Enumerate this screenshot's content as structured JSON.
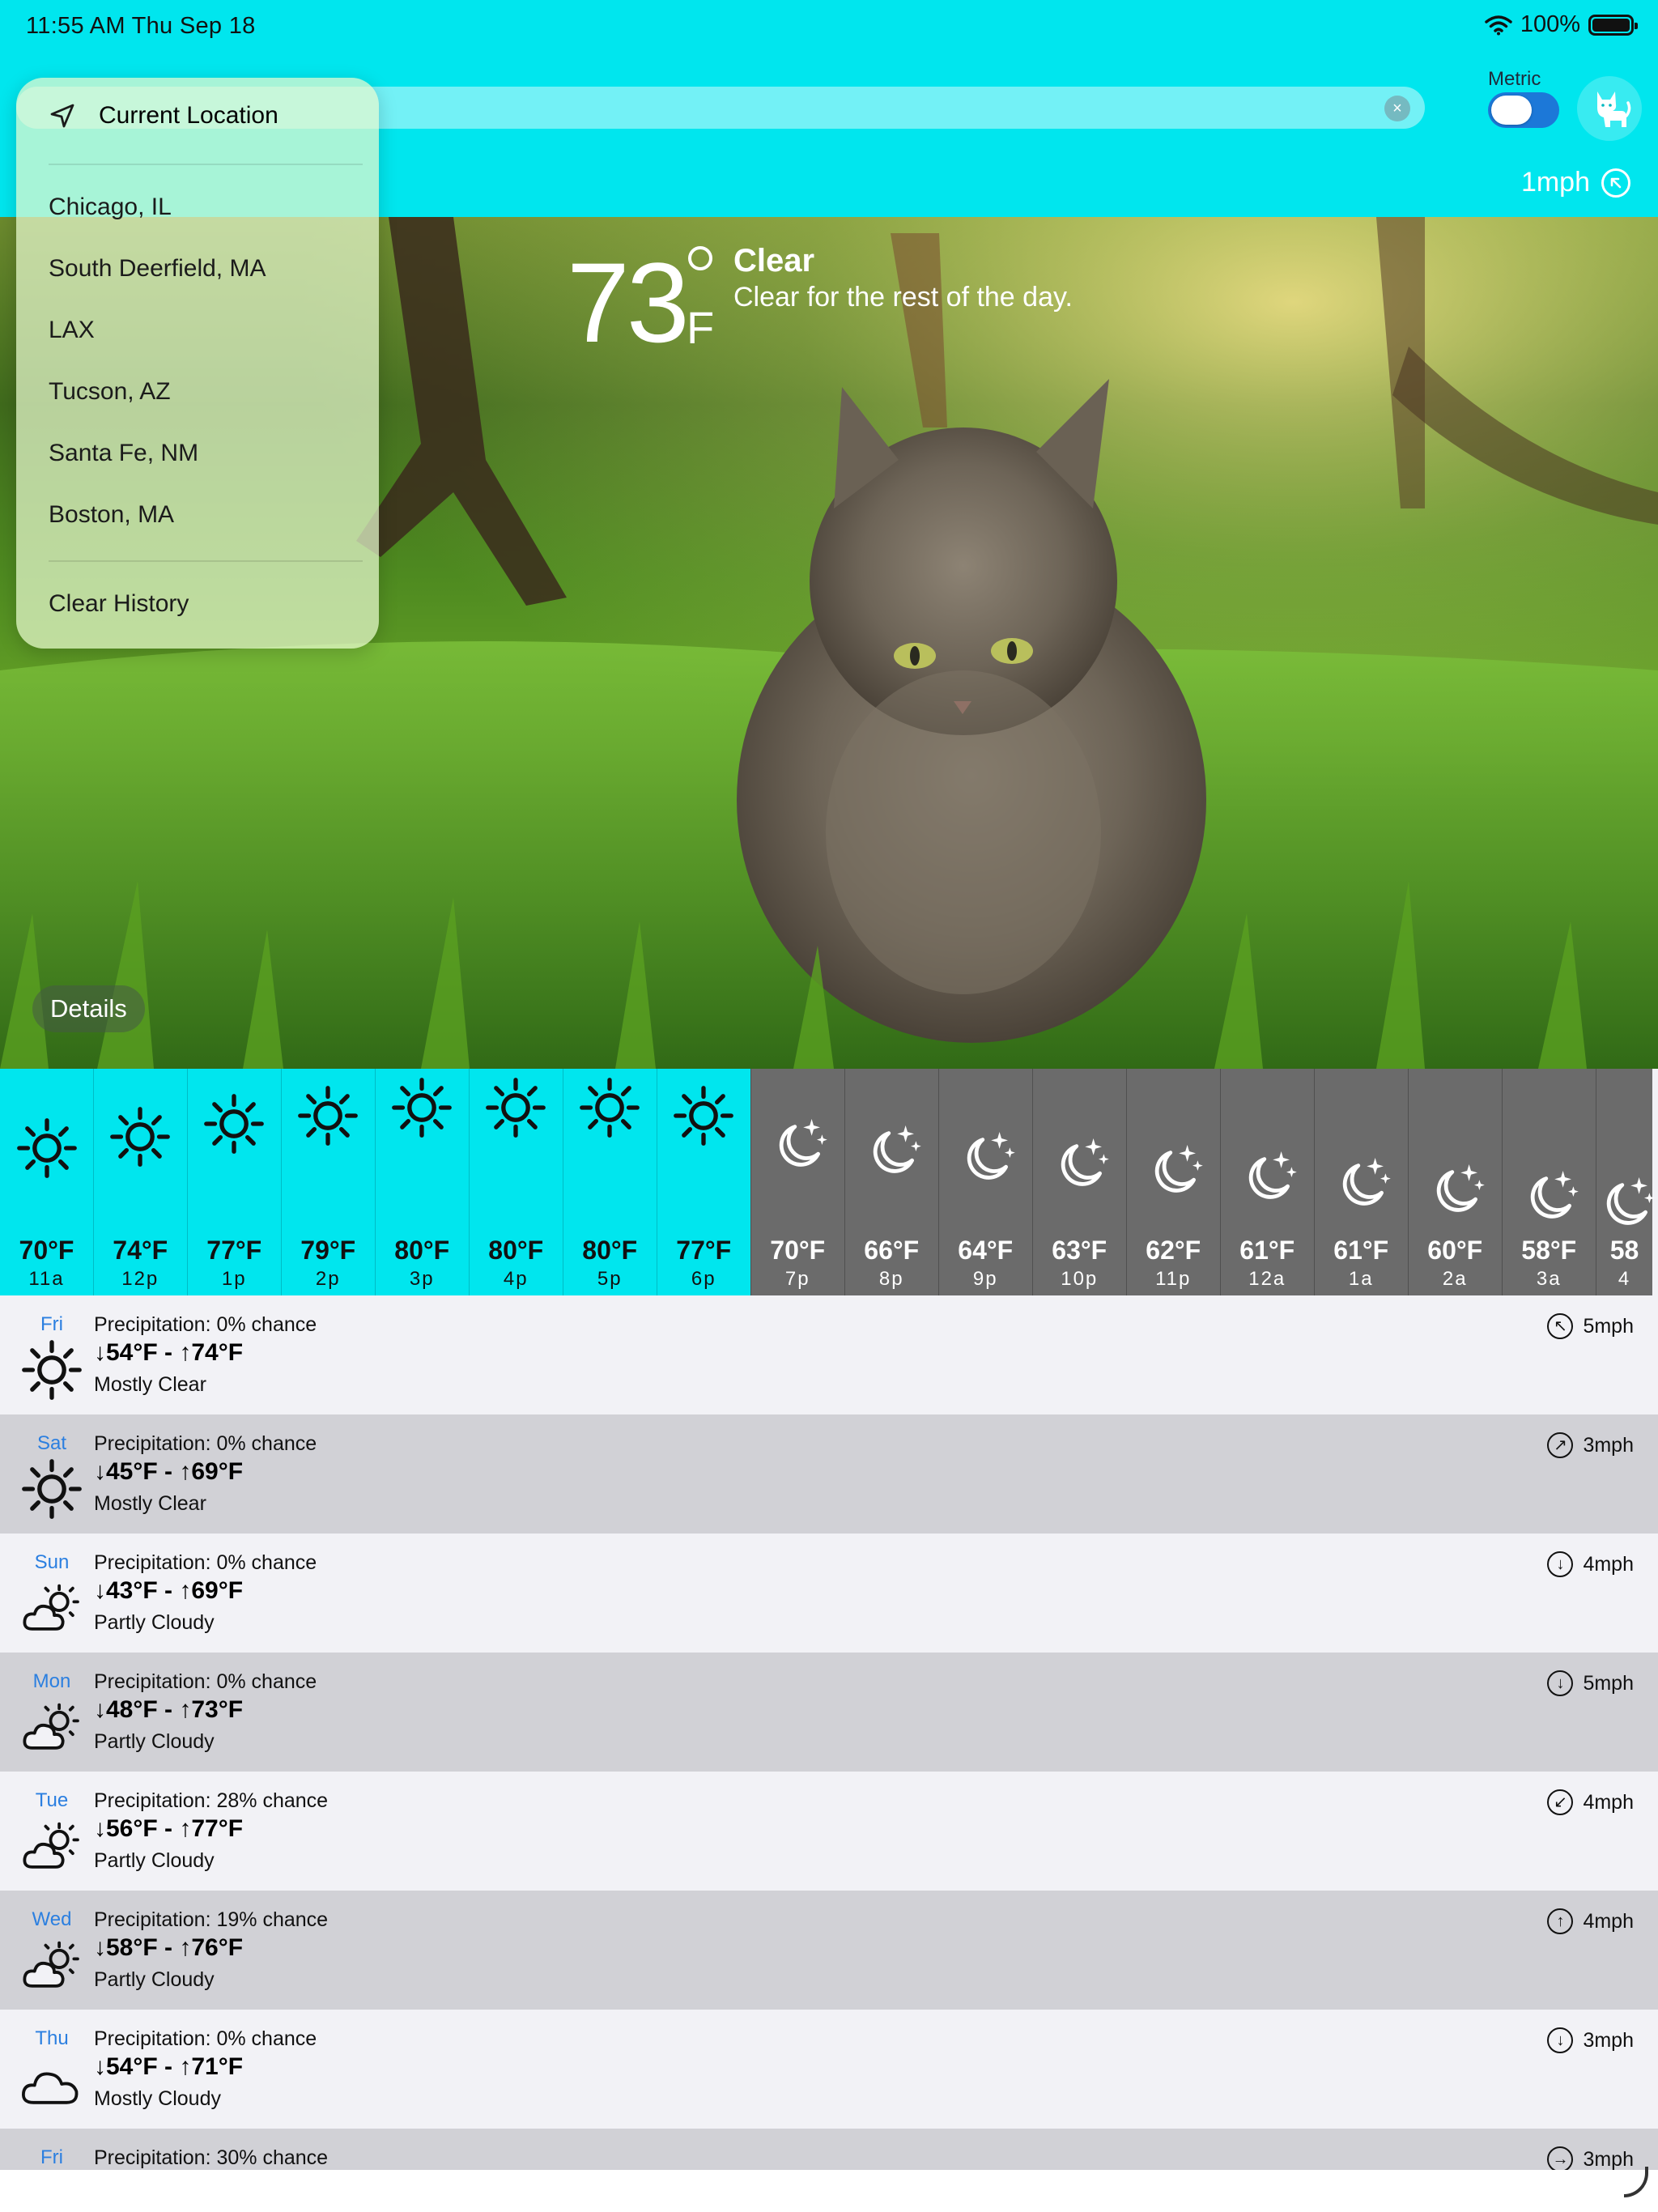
{
  "status": {
    "time": "11:55 AM   Thu Sep 18",
    "battery": "100%"
  },
  "search": {
    "clear_glyph": "×"
  },
  "toggle": {
    "label": "Metric",
    "on": true
  },
  "current": {
    "wind": "1mph",
    "temperature": "73",
    "unit": "F",
    "condition": "Clear",
    "summary": "Clear for the rest of the day."
  },
  "details_label": "Details",
  "dropdown": {
    "current_location": "Current Location",
    "items": [
      "Chicago, IL",
      "South Deerfield, MA",
      "LAX",
      "Tucson, AZ",
      "Santa Fe, NM",
      "Boston, MA"
    ],
    "clear_history": "Clear History"
  },
  "hourly": [
    {
      "temp": "70°F",
      "time": "11a",
      "icon": "sun-icon"
    },
    {
      "temp": "74°F",
      "time": "12p",
      "icon": "sun-icon"
    },
    {
      "temp": "77°F",
      "time": "1p",
      "icon": "sun-icon"
    },
    {
      "temp": "79°F",
      "time": "2p",
      "icon": "sun-icon"
    },
    {
      "temp": "80°F",
      "time": "3p",
      "icon": "sun-icon"
    },
    {
      "temp": "80°F",
      "time": "4p",
      "icon": "sun-icon"
    },
    {
      "temp": "80°F",
      "time": "5p",
      "icon": "sun-icon"
    },
    {
      "temp": "77°F",
      "time": "6p",
      "icon": "sun-icon"
    },
    {
      "temp": "70°F",
      "time": "7p",
      "icon": "moon-stars-icon"
    },
    {
      "temp": "66°F",
      "time": "8p",
      "icon": "moon-stars-icon"
    },
    {
      "temp": "64°F",
      "time": "9p",
      "icon": "moon-stars-icon"
    },
    {
      "temp": "63°F",
      "time": "10p",
      "icon": "moon-stars-icon"
    },
    {
      "temp": "62°F",
      "time": "11p",
      "icon": "moon-stars-icon"
    },
    {
      "temp": "61°F",
      "time": "12a",
      "icon": "moon-stars-icon"
    },
    {
      "temp": "61°F",
      "time": "1a",
      "icon": "moon-stars-icon"
    },
    {
      "temp": "60°F",
      "time": "2a",
      "icon": "moon-stars-icon"
    },
    {
      "temp": "58°F",
      "time": "3a",
      "icon": "moon-stars-icon"
    },
    {
      "temp": "58",
      "time": "4",
      "icon": "moon-stars-icon"
    }
  ],
  "daily": [
    {
      "day": "Fri",
      "precip": "Precipitation: 0% chance",
      "range": "↓54°F - ↑74°F",
      "condition": "Mostly Clear",
      "wind": "5mph",
      "wind_arrow": "↖",
      "icon": "sun-icon"
    },
    {
      "day": "Sat",
      "precip": "Precipitation: 0% chance",
      "range": "↓45°F - ↑69°F",
      "condition": "Mostly Clear",
      "wind": "3mph",
      "wind_arrow": "↗",
      "icon": "sun-icon"
    },
    {
      "day": "Sun",
      "precip": "Precipitation: 0% chance",
      "range": "↓43°F - ↑69°F",
      "condition": "Partly Cloudy",
      "wind": "4mph",
      "wind_arrow": "↓",
      "icon": "partly-cloudy-icon"
    },
    {
      "day": "Mon",
      "precip": "Precipitation: 0% chance",
      "range": "↓48°F - ↑73°F",
      "condition": "Partly Cloudy",
      "wind": "5mph",
      "wind_arrow": "↓",
      "icon": "partly-cloudy-icon"
    },
    {
      "day": "Tue",
      "precip": "Precipitation: 28% chance",
      "range": "↓56°F - ↑77°F",
      "condition": "Partly Cloudy",
      "wind": "4mph",
      "wind_arrow": "↙",
      "icon": "partly-cloudy-icon"
    },
    {
      "day": "Wed",
      "precip": "Precipitation: 19% chance",
      "range": "↓58°F - ↑76°F",
      "condition": "Partly Cloudy",
      "wind": "4mph",
      "wind_arrow": "↑",
      "icon": "partly-cloudy-icon"
    },
    {
      "day": "Thu",
      "precip": "Precipitation: 0% chance",
      "range": "↓54°F - ↑71°F",
      "condition": "Mostly Cloudy",
      "wind": "3mph",
      "wind_arrow": "↓",
      "icon": "cloud-icon"
    },
    {
      "day": "Fri",
      "precip": "Precipitation: 30% chance",
      "range": "",
      "condition": "",
      "wind": "3mph",
      "wind_arrow": "→",
      "icon": "cloud-icon"
    }
  ],
  "colors": {
    "accent": "#00e6ee",
    "night": "#6b6b6b",
    "day_name": "#2b7fe0",
    "toggle": "#1c78d8"
  }
}
